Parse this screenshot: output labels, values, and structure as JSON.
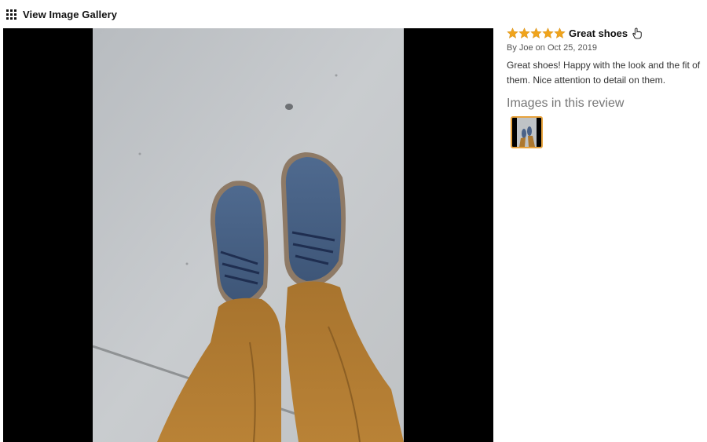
{
  "header": {
    "gallery_label": "View Image Gallery",
    "icon": "grid-icon"
  },
  "review": {
    "rating": 5,
    "rating_max": 5,
    "title": "Great shoes",
    "byline": "By Joe on Oct 25, 2019",
    "body": "Great shoes! Happy with the look and the fit of them. Nice attention to detail on them.",
    "helpful_icon": "hand-pointer-icon"
  },
  "images_section": {
    "heading": "Images in this review",
    "thumbnails": 1
  },
  "colors": {
    "star": "#f0a41c",
    "thumb_border": "#e8a33d",
    "viewer_bg": "#000000"
  }
}
